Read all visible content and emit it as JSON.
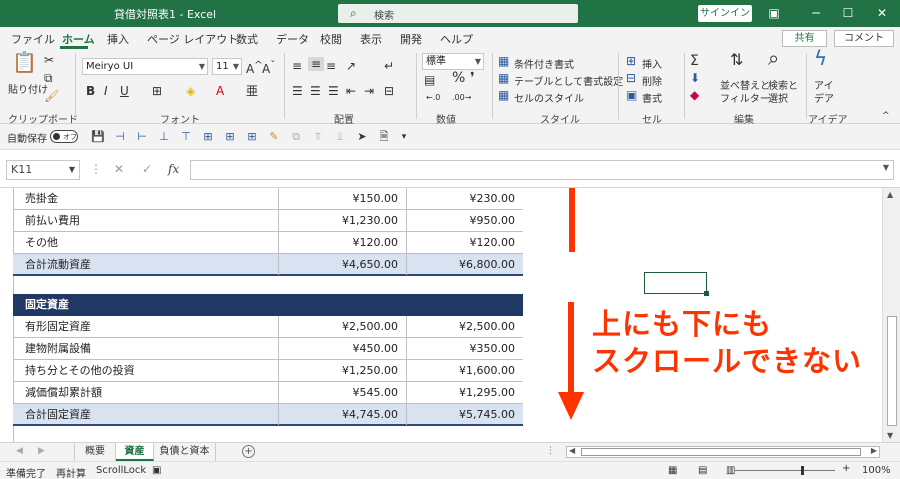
{
  "window": {
    "title": "貸借対照表1 - Excel",
    "search_placeholder": "検索",
    "signin": "サインイン",
    "restore_icon": "restore-icon",
    "minimize": "─",
    "maximize": "☐",
    "close": "✕"
  },
  "ribbon_tabs": [
    "ファイル",
    "ホーム",
    "挿入",
    "ページ レイアウト",
    "数式",
    "データ",
    "校閲",
    "表示",
    "開発",
    "ヘルプ"
  ],
  "active_tab": "ホーム",
  "share_label": "共有",
  "comment_label": "コメント",
  "ribbon": {
    "clipboard": {
      "paste": "貼り付け",
      "label": "クリップボード"
    },
    "font": {
      "name": "Meiryo UI",
      "size": "11",
      "label": "フォント"
    },
    "alignment": {
      "label": "配置"
    },
    "number": {
      "format": "標準",
      "label": "数値"
    },
    "styles": {
      "conditional": "条件付き書式",
      "table": "テーブルとして書式設定",
      "cell_styles": "セルのスタイル",
      "label": "スタイル"
    },
    "cells": {
      "insert": "挿入",
      "delete": "削除",
      "format": "書式",
      "label": "セル"
    },
    "editing": {
      "sort_line1": "並べ替えと",
      "sort_line2": "フィルター",
      "find_line1": "検索と",
      "find_line2": "選択",
      "label": "編集"
    },
    "ideas": {
      "line1": "アイ",
      "line2": "デア",
      "label": "アイデア"
    }
  },
  "qat": {
    "autosave": "自動保存",
    "toggle_state": "オフ"
  },
  "formula_bar": {
    "name_box": "K11",
    "fx": "fx",
    "formula": ""
  },
  "table": {
    "rows_top": [
      {
        "label": "売掛金",
        "v1": "¥150.00",
        "v2": "¥230.00"
      },
      {
        "label": "前払い費用",
        "v1": "¥1,230.00",
        "v2": "¥950.00"
      },
      {
        "label": "その他",
        "v1": "¥120.00",
        "v2": "¥120.00"
      }
    ],
    "total_current": {
      "label": "合計流動資産",
      "v1": "¥4,650.00",
      "v2": "¥6,800.00"
    },
    "section_header": "固定資産",
    "rows_fixed": [
      {
        "label": "有形固定資産",
        "v1": "¥2,500.00",
        "v2": "¥2,500.00"
      },
      {
        "label": "建物附属設備",
        "v1": "¥450.00",
        "v2": "¥350.00"
      },
      {
        "label": "持ち分とその他の投資",
        "v1": "¥1,250.00",
        "v2": "¥1,600.00"
      },
      {
        "label": "減価償却累計額",
        "v1": "¥545.00",
        "v2": "¥1,295.00"
      }
    ],
    "total_fixed": {
      "label": "合計固定資産",
      "v1": "¥4,745.00",
      "v2": "¥5,745.00"
    }
  },
  "annotation": {
    "line1": "上にも下にも",
    "line2": "スクロールできない",
    "color": "#ff3300"
  },
  "sheet_tabs": [
    "概要",
    "資産",
    "負債と資本"
  ],
  "active_sheet": "資産",
  "status": {
    "ready": "準備完了",
    "recalc": "再計算",
    "scroll_lock": "ScrollLock",
    "zoom": "100%"
  },
  "colors": {
    "excel_green": "#217346",
    "header_navy": "#203864",
    "total_fill": "#d9e2f1"
  }
}
